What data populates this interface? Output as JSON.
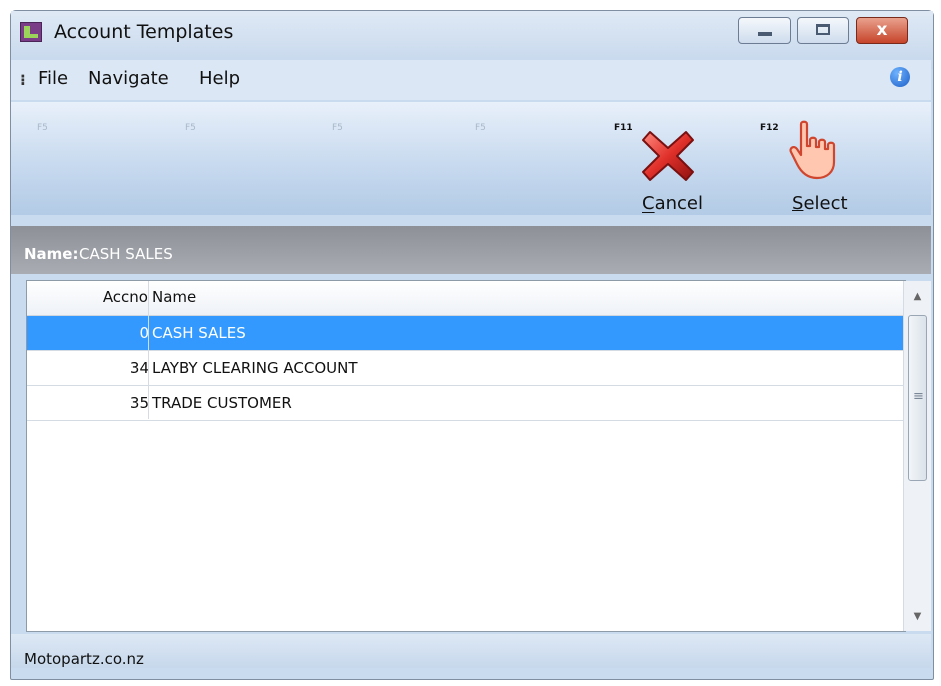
{
  "window": {
    "title": "Account Templates",
    "minimize_icon": "minimize-icon",
    "maximize_icon": "maximize-icon",
    "close_label": "x"
  },
  "menu": {
    "items": [
      "File",
      "Navigate",
      "Help"
    ],
    "info_icon": "info-icon",
    "info_glyph": "i"
  },
  "toolbar": {
    "fkeys": [
      "F5",
      "F5",
      "F5",
      "F5",
      "F11",
      "F12"
    ],
    "cancel_label": "Cancel",
    "select_label": "Select",
    "cancel_icon": "red-x-icon",
    "select_icon": "pointing-hand-icon"
  },
  "name_bar": {
    "label": "Name:",
    "value": "CASH SALES"
  },
  "grid": {
    "columns": [
      "Accno",
      "Name"
    ],
    "rows": [
      {
        "accno": "0",
        "name": "CASH SALES",
        "selected": true
      },
      {
        "accno": "34",
        "name": "LAYBY CLEARING ACCOUNT",
        "selected": false
      },
      {
        "accno": "35",
        "name": "TRADE CUSTOMER",
        "selected": false
      }
    ]
  },
  "status": {
    "text": "Motopartz.co.nz"
  },
  "colors": {
    "selection": "#3399ff",
    "name_bar": "#9a9ea4",
    "close_button": "#c6442a"
  }
}
